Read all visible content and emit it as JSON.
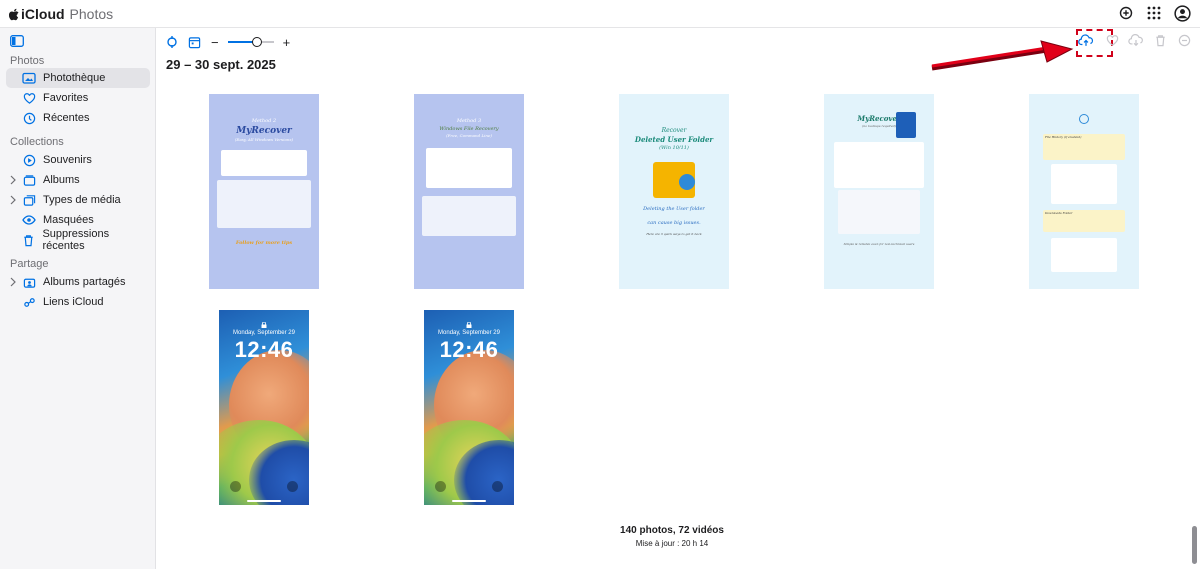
{
  "app": {
    "brand_bold": "iCloud",
    "brand_light": "Photos"
  },
  "topbar": {
    "icons": [
      "add-icon",
      "apps-grid-icon",
      "account-icon"
    ]
  },
  "sidebar": {
    "sections": [
      {
        "title": "Photos",
        "items": [
          {
            "label": "Photothèque",
            "icon": "library-icon",
            "active": true
          },
          {
            "label": "Favorites",
            "icon": "heart-icon"
          },
          {
            "label": "Récentes",
            "icon": "clock-icon"
          }
        ]
      },
      {
        "title": "Collections",
        "items": [
          {
            "label": "Souvenirs",
            "icon": "memories-icon"
          },
          {
            "label": "Albums",
            "icon": "album-icon",
            "expandable": true
          },
          {
            "label": "Types de média",
            "icon": "media-types-icon",
            "expandable": true
          },
          {
            "label": "Masquées",
            "icon": "eye-hidden-icon"
          },
          {
            "label": "Suppressions récentes",
            "icon": "trash-icon"
          }
        ]
      },
      {
        "title": "Partage",
        "items": [
          {
            "label": "Albums partagés",
            "icon": "shared-album-icon",
            "expandable": true
          },
          {
            "label": "Liens iCloud",
            "icon": "link-icon"
          }
        ]
      }
    ]
  },
  "toolbar": {
    "zoom_minus": "−",
    "zoom_plus": "+"
  },
  "main": {
    "date_heading": "29 – 30 sept. 2025",
    "footer_count": "140 photos, 72 vidéos",
    "footer_sync": "Mise à jour : 20 h 14"
  },
  "actions": [
    "upload-cloud-icon",
    "favorite-icon",
    "download-cloud-icon",
    "delete-icon",
    "more-icon"
  ],
  "thumbnails": {
    "t1": {
      "line1": "Method 2",
      "line2": "MyRecover",
      "line3": "(Easy, All Windows Versions)",
      "footer": "Follow for more tips"
    },
    "t2": {
      "line1": "Method 3",
      "line2": "Windows File Recovery",
      "line3": "(Free, Command Line)"
    },
    "t3": {
      "line1": "Recover",
      "line2": "Deleted User Folder",
      "line3": "(Win 10/11)",
      "line4": "Deleting the User folder",
      "line5": "can cause big issues.",
      "footer": "Here are 3 quick ways to get it back"
    },
    "t4": {
      "line1": "MyRecover",
      "line2": "(no backups required)",
      "footer": "Simple & reliable even for non-technical users"
    },
    "t5": {
      "line1": "File History (if enabled)",
      "line2": "Downloads Folder"
    },
    "phone1": {
      "date": "Monday, September 29",
      "time": "12:46"
    },
    "phone2": {
      "date": "Monday, September 29",
      "time": "12:46"
    }
  },
  "colors": {
    "accent": "#0071e3",
    "annotation": "#d0021b"
  }
}
